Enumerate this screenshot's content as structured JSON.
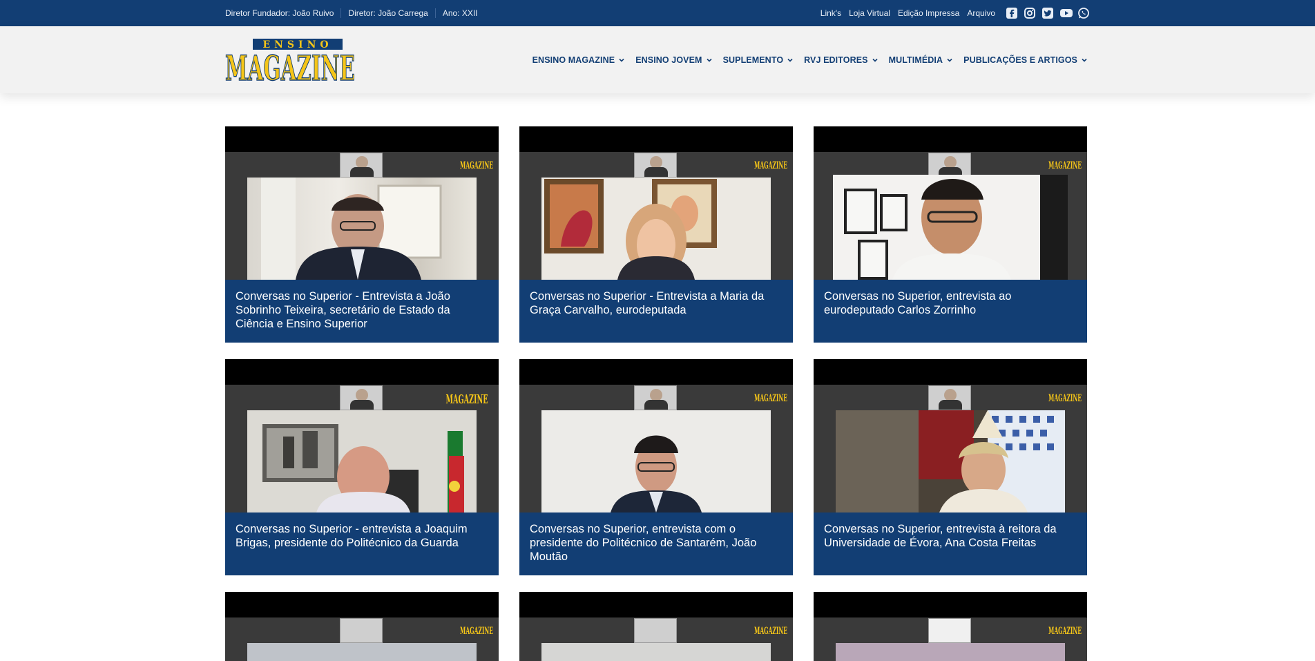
{
  "topbar": {
    "founder": "Diretor Fundador: João Ruivo",
    "director": "Diretor: João Carrega",
    "year": "Ano: XXII",
    "links": [
      "Link's",
      "Loja Virtual",
      "Edição Impressa",
      "Arquivo"
    ],
    "social_icons": [
      "facebook-icon",
      "instagram-icon",
      "twitter-icon",
      "youtube-icon",
      "whatsapp-icon"
    ]
  },
  "logo": {
    "top": "ENSINO",
    "main": "MAGAZINE"
  },
  "nav": [
    "ENSINO MAGAZINE",
    "ENSINO JOVEM",
    "SUPLEMENTO",
    "RVJ EDITORES",
    "MULTIMÉDIA",
    "PUBLICAÇÕES E ARTIGOS"
  ],
  "cards": [
    "Conversas no Superior - Entrevista a João Sobrinho Teixeira, secretário de Estado da Ciência e Ensino Superior",
    "Conversas no Superior - Entrevista a Maria da Graça Carvalho, eurodeputada",
    "Conversas no Superior, entrevista ao eurodeputado Carlos Zorrinho",
    "Conversas no Superior - entrevista a Joaquim Brigas, presidente do Politécnico da Guarda",
    "Conversas no Superior, entrevista com o presidente do Politécnico de Santarém, João Moutão",
    "Conversas no Superior, entrevista à reitora da Universidade de Évora, Ana Costa Freitas"
  ],
  "colors": {
    "brand_blue": "#123e74",
    "logo_yellow": "#f5c518"
  }
}
